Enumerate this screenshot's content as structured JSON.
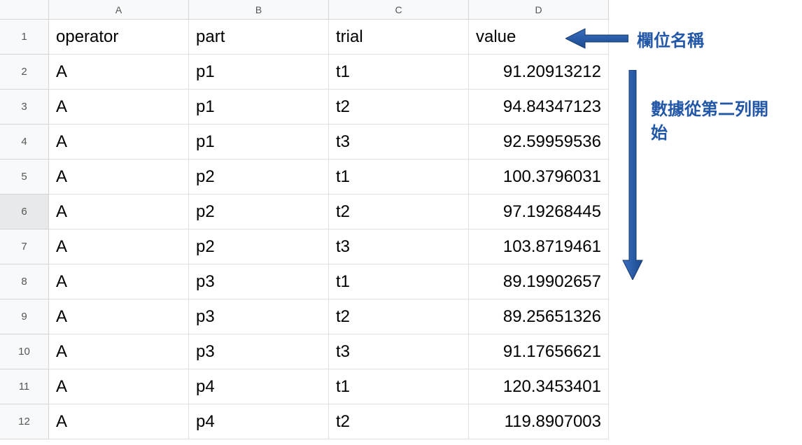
{
  "columns": [
    "A",
    "B",
    "C",
    "D"
  ],
  "headers": {
    "A": "operator",
    "B": "part",
    "C": "trial",
    "D": "value"
  },
  "rows": [
    {
      "n": "1",
      "A": "operator",
      "B": "part",
      "C": "trial",
      "D": "value",
      "isHeader": true
    },
    {
      "n": "2",
      "A": "A",
      "B": "p1",
      "C": "t1",
      "D": "91.20913212"
    },
    {
      "n": "3",
      "A": "A",
      "B": "p1",
      "C": "t2",
      "D": "94.84347123"
    },
    {
      "n": "4",
      "A": "A",
      "B": "p1",
      "C": "t3",
      "D": "92.59959536"
    },
    {
      "n": "5",
      "A": "A",
      "B": "p2",
      "C": "t1",
      "D": "100.3796031"
    },
    {
      "n": "6",
      "A": "A",
      "B": "p2",
      "C": "t2",
      "D": "97.19268445",
      "selected": true
    },
    {
      "n": "7",
      "A": "A",
      "B": "p2",
      "C": "t3",
      "D": "103.8719461"
    },
    {
      "n": "8",
      "A": "A",
      "B": "p3",
      "C": "t1",
      "D": "89.19902657"
    },
    {
      "n": "9",
      "A": "A",
      "B": "p3",
      "C": "t2",
      "D": "89.25651326"
    },
    {
      "n": "10",
      "A": "A",
      "B": "p3",
      "C": "t3",
      "D": "91.17656621"
    },
    {
      "n": "11",
      "A": "A",
      "B": "p4",
      "C": "t1",
      "D": "120.3453401"
    },
    {
      "n": "12",
      "A": "A",
      "B": "p4",
      "C": "t2",
      "D": "119.8907003"
    }
  ],
  "annotations": {
    "label1": "欄位名稱",
    "label2": "數據從第二列開始"
  },
  "annotation_color": "#2257a8"
}
